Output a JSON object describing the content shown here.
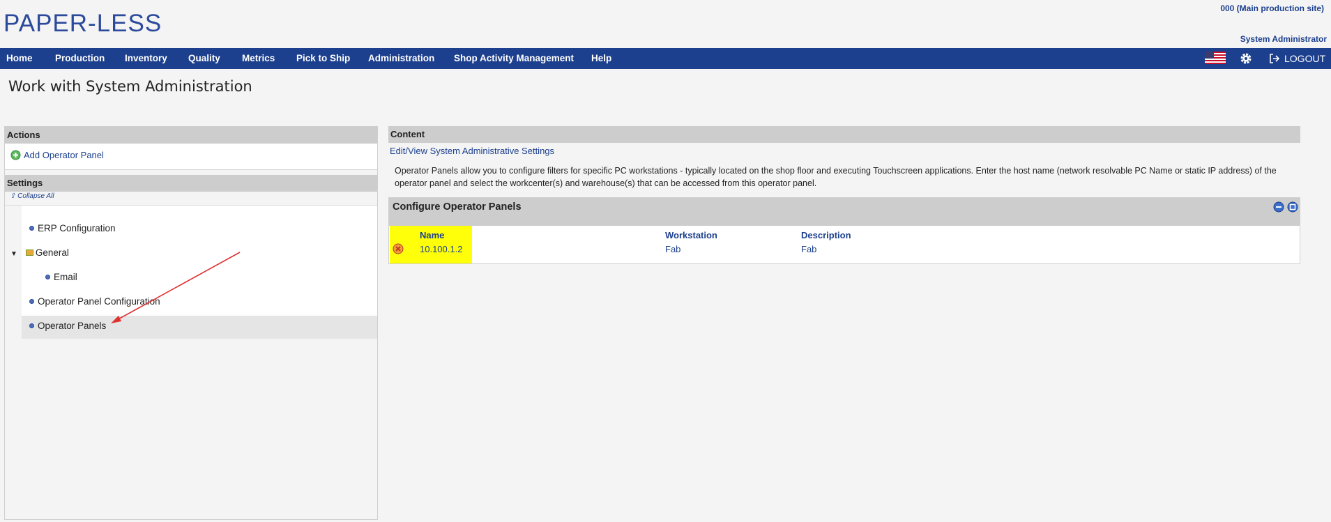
{
  "header": {
    "logo": "PAPER-LESS",
    "site": "000 (Main production site)",
    "user": "System Administrator"
  },
  "nav": {
    "items": [
      "Home",
      "Production",
      "Inventory",
      "Quality",
      "Metrics",
      "Pick to Ship",
      "Administration",
      "Shop Activity Management",
      "Help"
    ],
    "logout": "LOGOUT",
    "icons": {
      "flag": "us-flag-icon",
      "settings": "gear-icon",
      "logout": "logout-icon"
    },
    "color": "#1c3f8e"
  },
  "page": {
    "title": "Work with System Administration"
  },
  "actions": {
    "heading": "Actions",
    "add_operator_panel": "Add Operator Panel"
  },
  "settings": {
    "heading": "Settings",
    "collapse_all": "Collapse All",
    "tree": [
      {
        "label": "ERP Configuration"
      },
      {
        "label": "General",
        "expanded": true
      },
      {
        "label": "Email",
        "child": true
      },
      {
        "label": "Operator Panel Configuration"
      },
      {
        "label": "Operator Panels",
        "selected": true
      }
    ]
  },
  "content": {
    "heading": "Content",
    "link": "Edit/View System Administrative Settings",
    "description": "Operator Panels allow you to configure filters for specific PC workstations - typically located on the shop floor and executing Touchscreen applications. Enter the host name (network resolvable PC Name or static IP address) of the operator panel and select the workcenter(s) and warehouse(s) that can be accessed from this operator panel.",
    "grid": {
      "title": "Configure Operator Panels",
      "columns": {
        "name": "Name",
        "workstation": "Workstation",
        "description": "Description"
      },
      "rows": [
        {
          "name": "10.100.1.2",
          "workstation": "Fab",
          "description": "Fab"
        }
      ]
    },
    "highlight_color": "#ffff0a"
  }
}
